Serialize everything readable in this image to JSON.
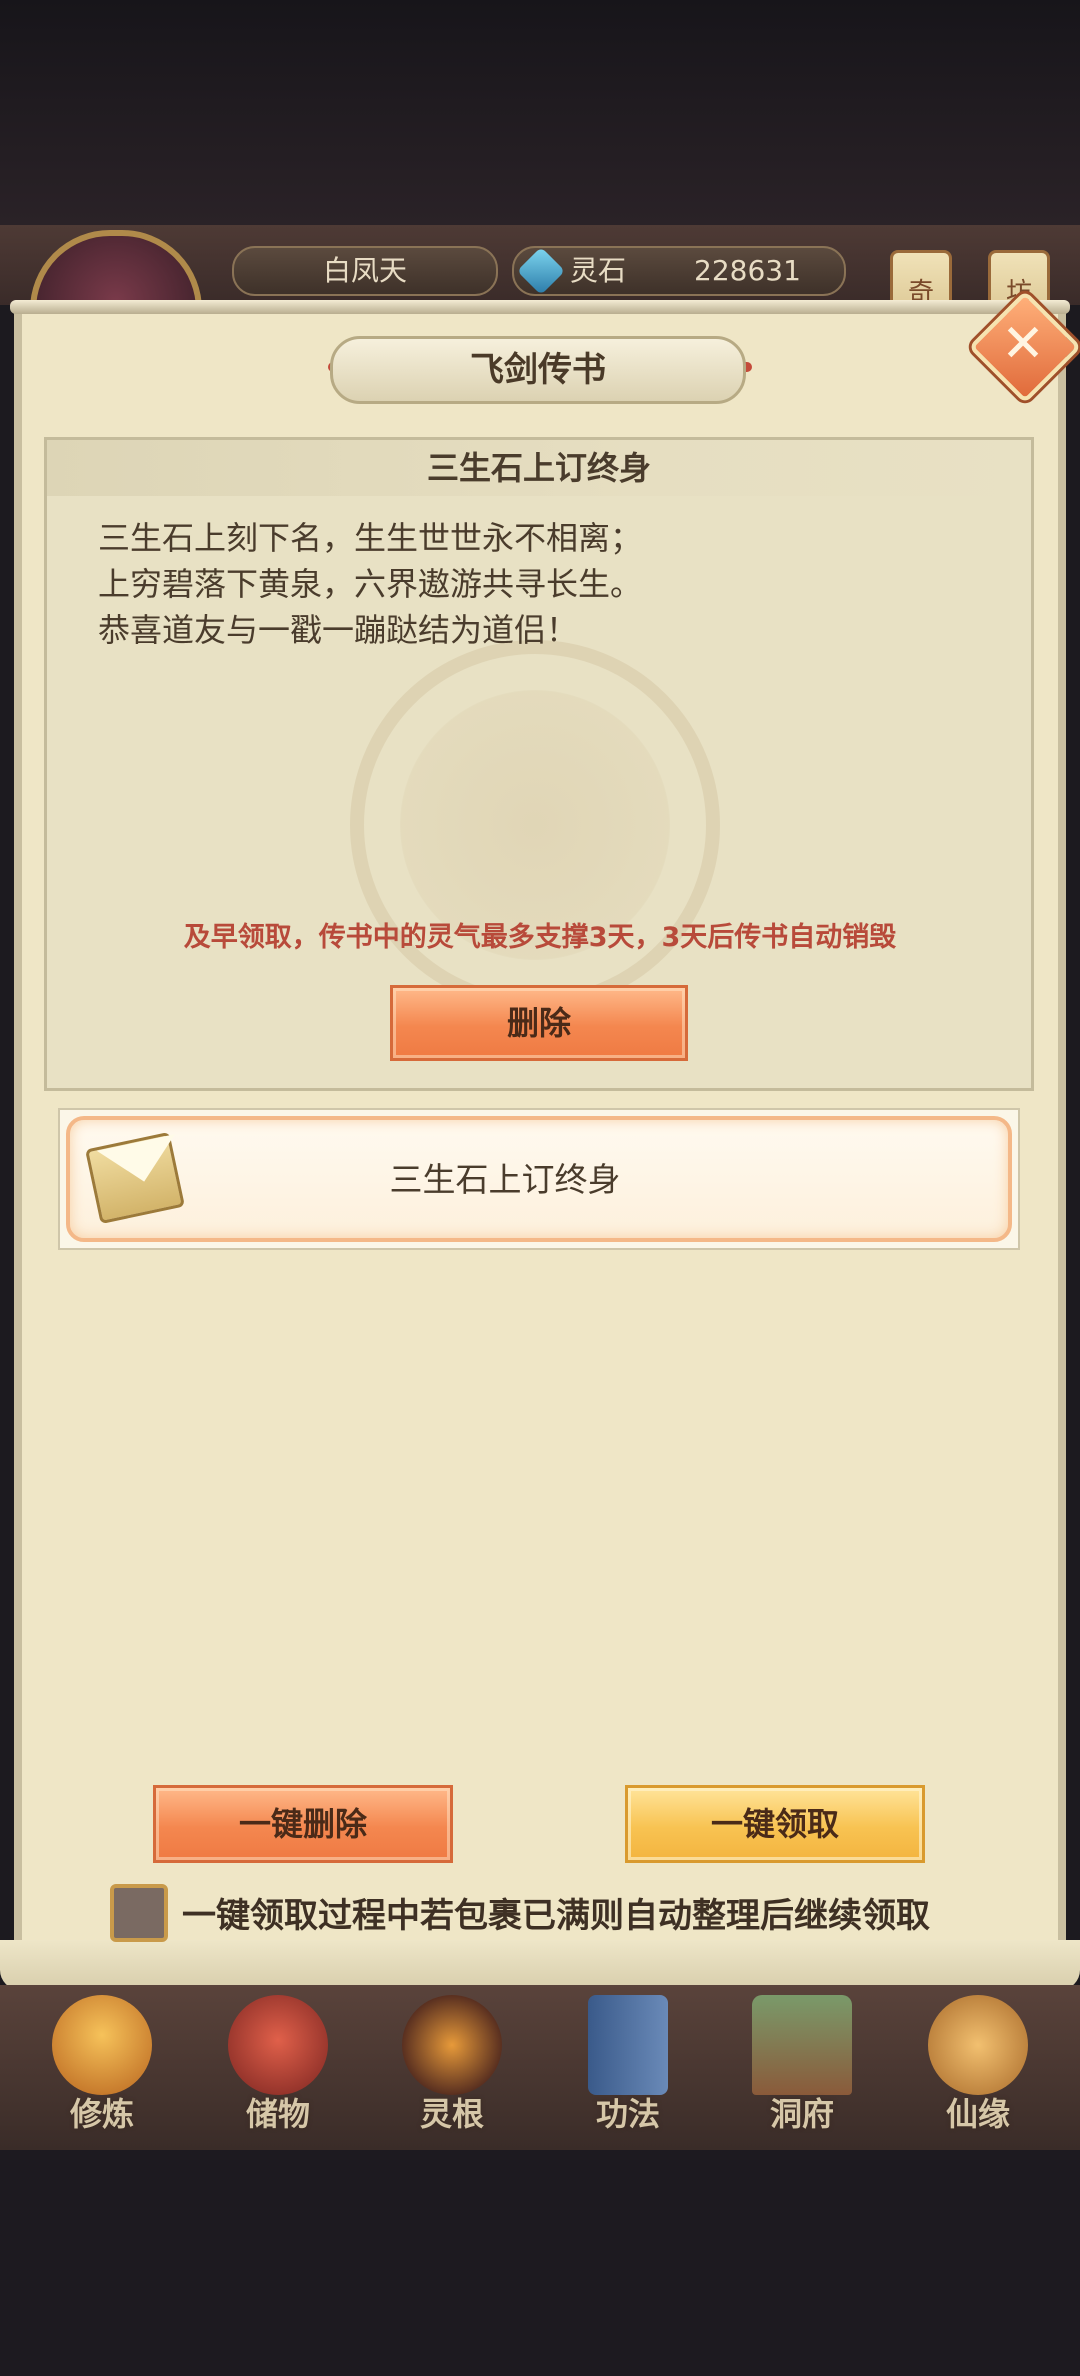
{
  "hud": {
    "player_name": "白凤天",
    "currency_label": "灵石",
    "currency_value": "228631",
    "tag_left": "奇",
    "tag_right": "坊"
  },
  "dialog": {
    "title": "飞剑传书",
    "mail": {
      "subject": "三生石上订终身",
      "body": [
        "三生石上刻下名，生生世世永不相离；",
        "上穷碧落下黄泉，六界遨游共寻长生。",
        "恭喜道友与一戳一蹦跶结为道侣！"
      ],
      "warning": "及早领取，传书中的灵气最多支撑3天，3天后传书自动销毁",
      "delete_label": "删除"
    },
    "list": [
      {
        "subject": "三生石上订终身"
      }
    ],
    "bulk_delete_label": "一键删除",
    "bulk_claim_label": "一键领取",
    "auto_sort_label": "一键领取过程中若包裹已满则自动整理后继续领取"
  },
  "bottom_nav": {
    "items": [
      {
        "label": "修炼",
        "icon": "cultivation-icon"
      },
      {
        "label": "储物",
        "icon": "storage-bag-icon"
      },
      {
        "label": "灵根",
        "icon": "spirit-root-icon"
      },
      {
        "label": "功法",
        "icon": "technique-book-icon"
      },
      {
        "label": "洞府",
        "icon": "cave-dwelling-icon"
      },
      {
        "label": "仙缘",
        "icon": "immortal-fate-icon"
      }
    ]
  },
  "colors": {
    "panel_bg": "#efe6c6",
    "warning_text": "#b84a3a",
    "orange_button": "#f4874f",
    "yellow_button": "#f8c352"
  }
}
